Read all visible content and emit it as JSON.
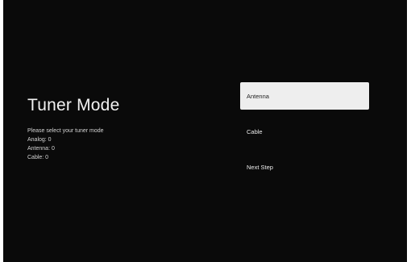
{
  "screen": {
    "title": "Tuner Mode",
    "instructions": "Please select your tuner mode",
    "status": [
      {
        "label": "Analog: 0"
      },
      {
        "label": "Antenna: 0"
      },
      {
        "label": "Cable: 0"
      }
    ]
  },
  "menu": {
    "items": [
      {
        "label": "Antenna",
        "selected": true
      },
      {
        "label": "Cable",
        "selected": false
      },
      {
        "label": "Next Step",
        "selected": false
      }
    ]
  },
  "colors": {
    "background": "#0a0a0a",
    "selected_item": "#eeeeee",
    "text": "#f2f2f2"
  }
}
